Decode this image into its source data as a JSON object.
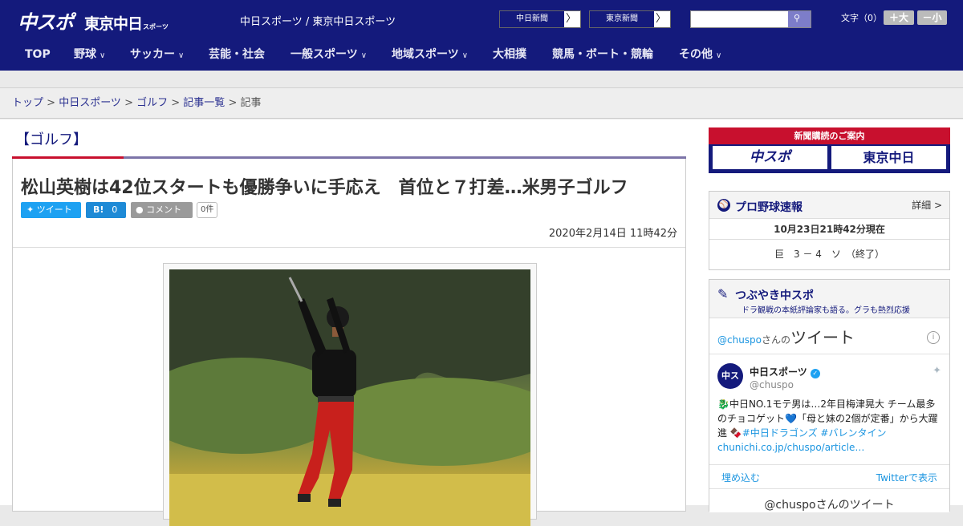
{
  "header": {
    "logo_main": "中スポ",
    "logo_sub": "東京中日",
    "logo_small": "スポーツ",
    "site_name": "中日スポーツ / 東京中日スポーツ",
    "paper_buttons": [
      "中日新聞",
      "東京新聞"
    ],
    "arrow": "〉",
    "search_placeholder": "",
    "font_size_label": "文字（0）",
    "font_plus": "＋大",
    "font_minus": "－小"
  },
  "nav": {
    "items": [
      {
        "label": "TOP",
        "has_menu": false
      },
      {
        "label": "野球",
        "has_menu": true
      },
      {
        "label": "サッカー",
        "has_menu": true
      },
      {
        "label": "芸能・社会",
        "has_menu": false
      },
      {
        "label": "一般スポーツ",
        "has_menu": true
      },
      {
        "label": "地域スポーツ",
        "has_menu": true
      },
      {
        "label": "大相撲",
        "has_menu": false
      },
      {
        "label": "競馬・ボート・競輪",
        "has_menu": false
      },
      {
        "label": "その他",
        "has_menu": true
      }
    ],
    "chevron": "∨"
  },
  "breadcrumb": {
    "items": [
      "トップ",
      "中日スポーツ",
      "ゴルフ",
      "記事一覧"
    ],
    "current": "記事",
    "sep": " > "
  },
  "article": {
    "category": "【ゴルフ】",
    "title": "松山英樹は42位スタートも優勝争いに手応え　首位と７打差…米男子ゴルフ",
    "tweet_label": "ツイート",
    "hatena_label": "B!",
    "hatena_count": "0",
    "comment_label": "コメント",
    "comment_count": "0件",
    "date": "2020年2月14日 11時42分"
  },
  "sidebar": {
    "subscribe": {
      "title": "新聞購読のご案内",
      "left": "中スポ",
      "right": "東京中日"
    },
    "baseball": {
      "title": "プロ野球速報",
      "detail": "詳細 >",
      "time": "10月23日21時42分現在",
      "game": "巨　3 － 4　ソ　（終了）"
    },
    "tweets": {
      "title": "つぶやき中スポ",
      "subtitle": "ドラ観戦の本紙評論家も語る。グラも熱烈応援",
      "widget_handle": "@chuspo",
      "widget_san": "さんの",
      "widget_word": "ツイート",
      "info": "i",
      "avatar_text": "中スポ",
      "user_name": "中日スポーツ",
      "user_handle": "@chuspo",
      "tweet_text": "🐉中日NO.1モテ男は…2年目梅津晃大 チーム最多のチョコゲット💙「母と妹の2個が定番」から大躍進 🍫",
      "tweet_tags": "#中日ドラゴンズ #バレンタイン",
      "tweet_link": "chunichi.co.jp/chuspo/article…",
      "embed": "埋め込む",
      "view": "Twitterで表示",
      "more": "@chuspoさんのツイート"
    }
  }
}
